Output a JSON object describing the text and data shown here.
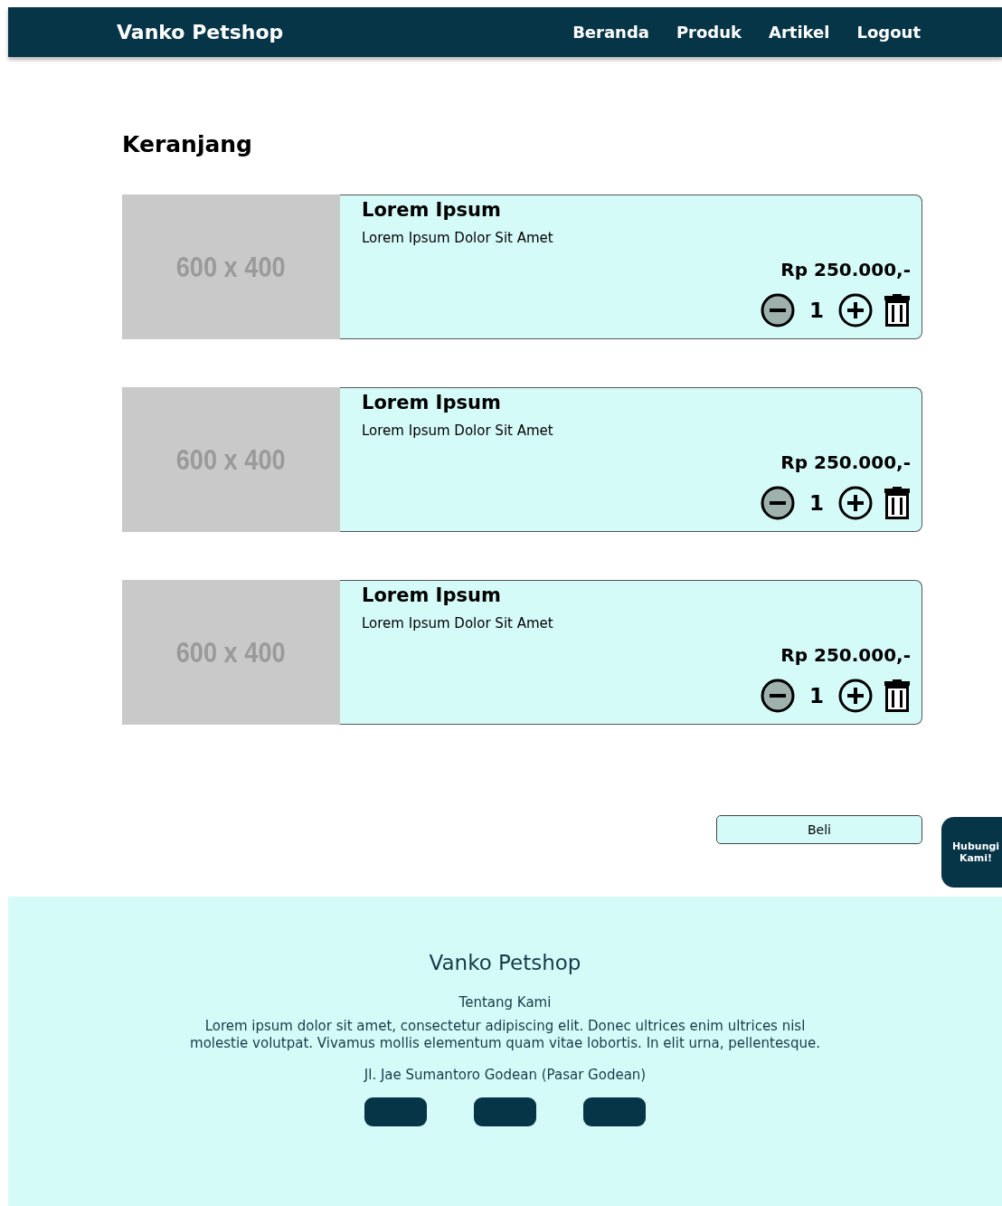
{
  "navbar": {
    "brand": "Vanko Petshop",
    "links": [
      {
        "label": "Beranda"
      },
      {
        "label": "Produk"
      },
      {
        "label": "Artikel"
      },
      {
        "label": "Logout"
      }
    ]
  },
  "page_title": "Keranjang",
  "cart_items": [
    {
      "image_label": "600 x 400",
      "name": "Lorem Ipsum",
      "description": "Lorem Ipsum Dolor Sit Amet",
      "price": "Rp 250.000,-",
      "quantity": "1"
    },
    {
      "image_label": "600 x 400",
      "name": "Lorem Ipsum",
      "description": "Lorem Ipsum Dolor Sit Amet",
      "price": "Rp 250.000,-",
      "quantity": "1"
    },
    {
      "image_label": "600 x 400",
      "name": "Lorem Ipsum",
      "description": "Lorem Ipsum Dolor Sit Amet",
      "price": "Rp 250.000,-",
      "quantity": "1"
    }
  ],
  "buy_button": "Beli",
  "contact_button": "Hubungi Kami!",
  "footer": {
    "title": "Vanko Petshop",
    "subtitle": "Tentang Kami",
    "about": "Lorem ipsum dolor sit amet, consectetur adipiscing elit. Donec ultrices enim ultrices nisl molestie volutpat. Vivamus mollis elementum quam vitae lobortis. In elit urna, pellentesque.",
    "address": "Jl. Jae Sumantoro Godean (Pasar Godean)"
  }
}
